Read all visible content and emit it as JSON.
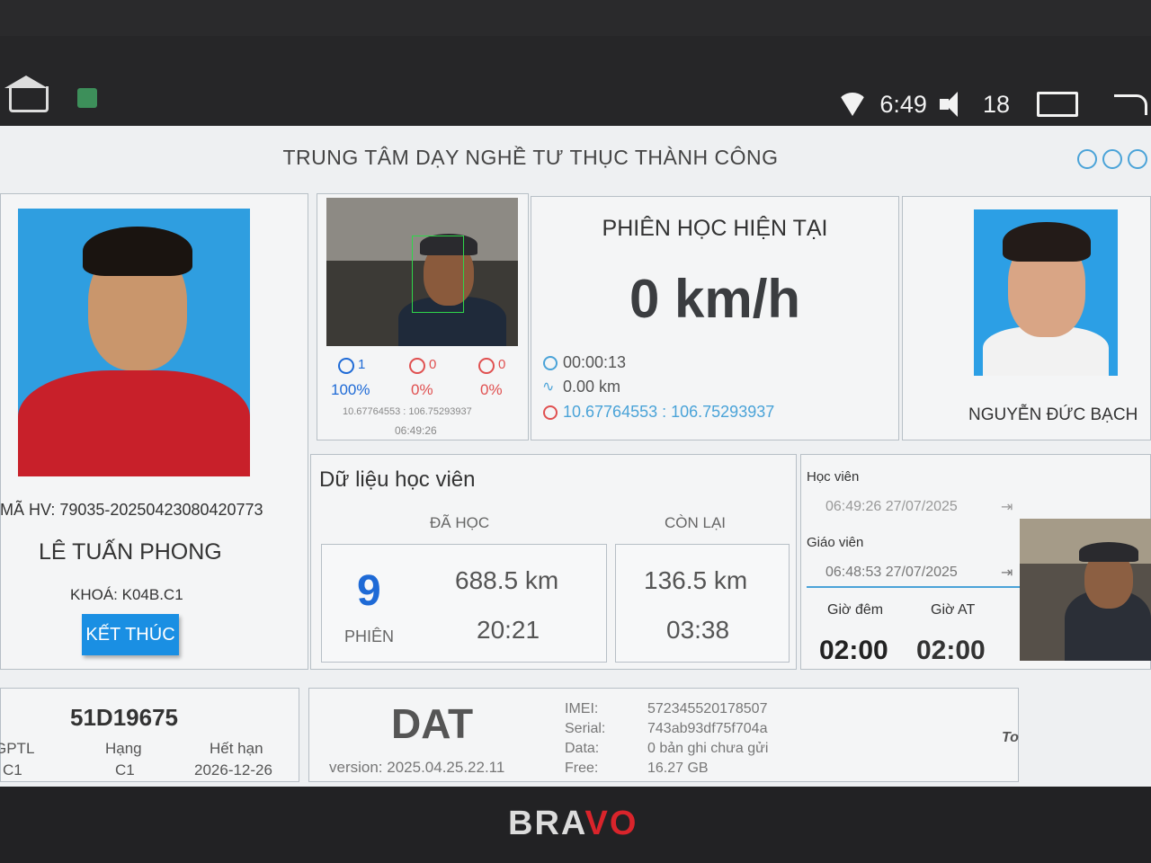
{
  "status_bar": {
    "time": "6:49",
    "volume": "18",
    "icons": [
      "home-icon",
      "app-icon",
      "wifi-icon",
      "volume-icon",
      "recent-apps-icon",
      "back-icon"
    ]
  },
  "header": {
    "title": "TRUNG TÂM DẠY NGHỀ TƯ THỤC THÀNH CÔNG",
    "icons": [
      "location-icon",
      "globe-icon",
      "camera-icon"
    ]
  },
  "student": {
    "id_label": "MÃ HV: 79035-20250423080420773",
    "name": "LÊ TUẤN PHONG",
    "course": "KHOÁ: K04B.C1",
    "end_button": "KẾT THÚC"
  },
  "camera": {
    "stats": [
      {
        "icon": "smile-icon",
        "count": "1",
        "pct": "100%"
      },
      {
        "icon": "neutral-face-icon",
        "count": "0",
        "pct": "0%"
      },
      {
        "icon": "error-icon",
        "count": "0",
        "pct": "0%"
      }
    ],
    "coords": "10.67764553 : 106.75293937",
    "time": "06:49:26"
  },
  "session": {
    "title": "PHIÊN HỌC HIỆN TẠI",
    "speed": "0 km/h",
    "duration": "00:00:13",
    "distance": "0.00 km",
    "gps": "10.67764553 : 106.75293937"
  },
  "teacher": {
    "name": "NGUYỄN ĐỨC BẠCH"
  },
  "student_data": {
    "title": "Dữ liệu học viên",
    "done_label": "ĐÃ HỌC",
    "remain_label": "CÒN LẠI",
    "sessions": "9",
    "sessions_label": "PHIÊN",
    "done_km": "688.5 km",
    "done_time": "20:21",
    "remain_km": "136.5 km",
    "remain_time": "03:38"
  },
  "login": {
    "student_label": "Học viên",
    "student_time": "06:49:26 27/07/2025",
    "teacher_label": "Giáo viên",
    "teacher_time": "06:48:53 27/07/2025",
    "night_label": "Giờ đêm",
    "night_value": "02:00",
    "auto_label": "Giờ AT",
    "auto_value": "02:00"
  },
  "vehicle": {
    "plate": "51D19675",
    "gptl_label": "GPTL",
    "gptl_value": "C1",
    "class_label": "Hạng",
    "class_value": "C1",
    "expiry_label": "Hết hạn",
    "expiry_value": "2026-12-26"
  },
  "device": {
    "brand": "DAT",
    "version": "version: 2025.04.25.22.11",
    "imei_label": "IMEI:",
    "imei": "572345520178507",
    "serial_label": "Serial:",
    "serial": "743ab93df75f704a",
    "data_label": "Data:",
    "data": "0 bản ghi chưa gửi",
    "free_label": "Free:",
    "free": "16.27 GB"
  },
  "pip_label": "To",
  "bezel_brand": {
    "prefix": "BRA",
    "suffix": "VO"
  }
}
